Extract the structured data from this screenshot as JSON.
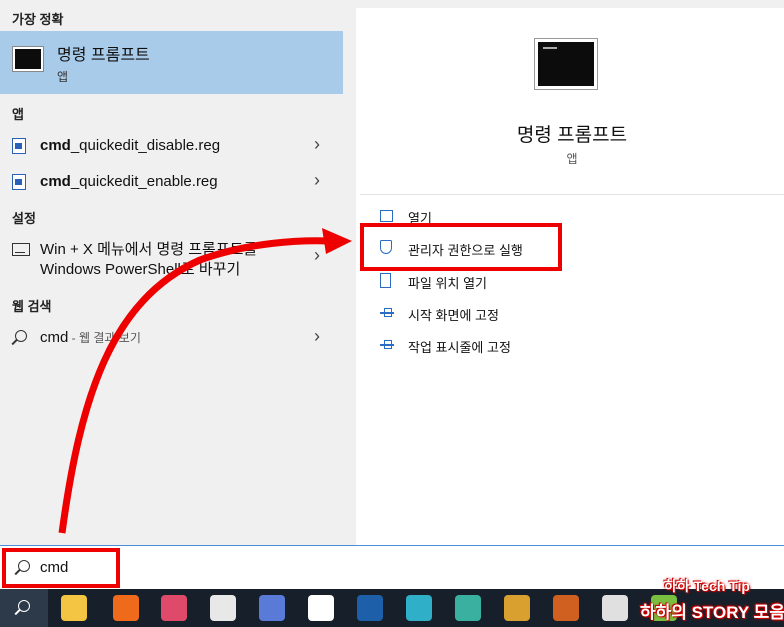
{
  "left": {
    "best_match_header": "가장 정확",
    "best_match": {
      "title": "명령 프롬프트",
      "subtitle": "앱"
    },
    "apps_header": "앱",
    "apps": [
      {
        "bold": "cmd",
        "rest": "_quickedit_disable.reg"
      },
      {
        "bold": "cmd",
        "rest": "_quickedit_enable.reg"
      }
    ],
    "settings_header": "설정",
    "setting_item": {
      "line1": "Win + X 메뉴에서 명령 프롬프트를",
      "line2": "Windows PowerShell로 바꾸기"
    },
    "web_header": "웹 검색",
    "web_item": {
      "query": "cmd",
      "suffix": " - 웹 결과 보기"
    },
    "chevron": "›"
  },
  "right": {
    "app_title": "명령 프롬프트",
    "app_sub": "앱",
    "actions": [
      "열기",
      "관리자 권한으로 실행",
      "파일 위치 열기",
      "시작 화면에 고정",
      "작업 표시줄에 고정"
    ]
  },
  "searchbar": {
    "value": "cmd"
  },
  "taskbar": {
    "apps": [
      {
        "icon": "file-explorer-icon",
        "color": "#f4c542"
      },
      {
        "icon": "app-c-icon",
        "color": "#f06a1c"
      },
      {
        "icon": "camera-app-icon",
        "color": "#e04a6a"
      },
      {
        "icon": "image-app-icon",
        "color": "#e8e8e8"
      },
      {
        "icon": "capture-icon",
        "color": "#5a7ad8"
      },
      {
        "icon": "document-icon",
        "color": "#ffffff"
      },
      {
        "icon": "v-app-icon",
        "color": "#1d5fa8"
      },
      {
        "icon": "edge-icon",
        "color": "#2fb0c8"
      },
      {
        "icon": "bird-app-icon",
        "color": "#3ab0a0"
      },
      {
        "icon": "chrome-icon",
        "color": "#d9a030"
      },
      {
        "icon": "striped-app-icon",
        "color": "#d06020"
      },
      {
        "icon": "ring-app-icon",
        "color": "#e0e0e0"
      },
      {
        "icon": "green-app-icon",
        "color": "#7ac040"
      }
    ]
  },
  "watermark": {
    "line1": "하하 Tech Tip",
    "line2": "하하의 STORY 모음"
  },
  "accent_red": "#e00000"
}
